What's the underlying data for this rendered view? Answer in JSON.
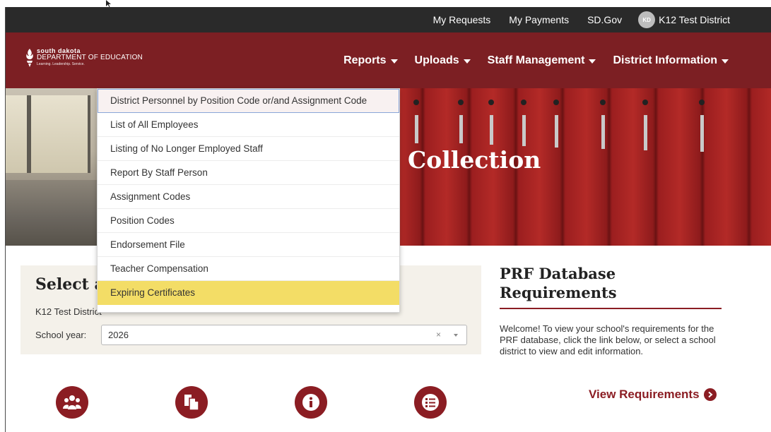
{
  "utility_nav": {
    "links": [
      "My Requests",
      "My Payments",
      "SD.Gov"
    ],
    "user": {
      "initials": "KD",
      "name": "K12 Test District"
    }
  },
  "logo": {
    "line1": "south dakota",
    "line2": "DEPARTMENT OF EDUCATION",
    "tagline": "Learning. Leadership. Service."
  },
  "main_nav": {
    "items": [
      "Reports",
      "Uploads",
      "Staff Management",
      "District Information"
    ]
  },
  "hero": {
    "title": "Collection"
  },
  "reports_dropdown": {
    "items": [
      "District Personnel by Position Code or/and Assignment Code",
      "List of All Employees",
      "Listing of No Longer Employed Staff",
      "Report By Staff Person",
      "Assignment Codes",
      "Position Codes",
      "Endorsement File",
      "Teacher Compensation",
      "Expiring Certificates"
    ],
    "hovered_index": 0,
    "selected_index": 8
  },
  "select_panel": {
    "title": "Select a",
    "district": "K12 Test District",
    "school_year_label": "School year:",
    "school_year_value": "2026",
    "clear_glyph": "×"
  },
  "quick_icons": [
    "users-icon",
    "documents-icon",
    "info-icon",
    "list-icon"
  ],
  "prf": {
    "title": "PRF Database Requirements",
    "body": "Welcome! To view your school's requirements for the PRF database, click the link below, or select a school district to view and edit information.",
    "link": "View Requirements"
  },
  "colors": {
    "utility_bar": "#2a2a2a",
    "brand_maroon": "#7c1f23",
    "accent_red": "#8b1d23",
    "selected_yellow": "#f3dd66",
    "panel_bg": "#f4f1ea"
  }
}
